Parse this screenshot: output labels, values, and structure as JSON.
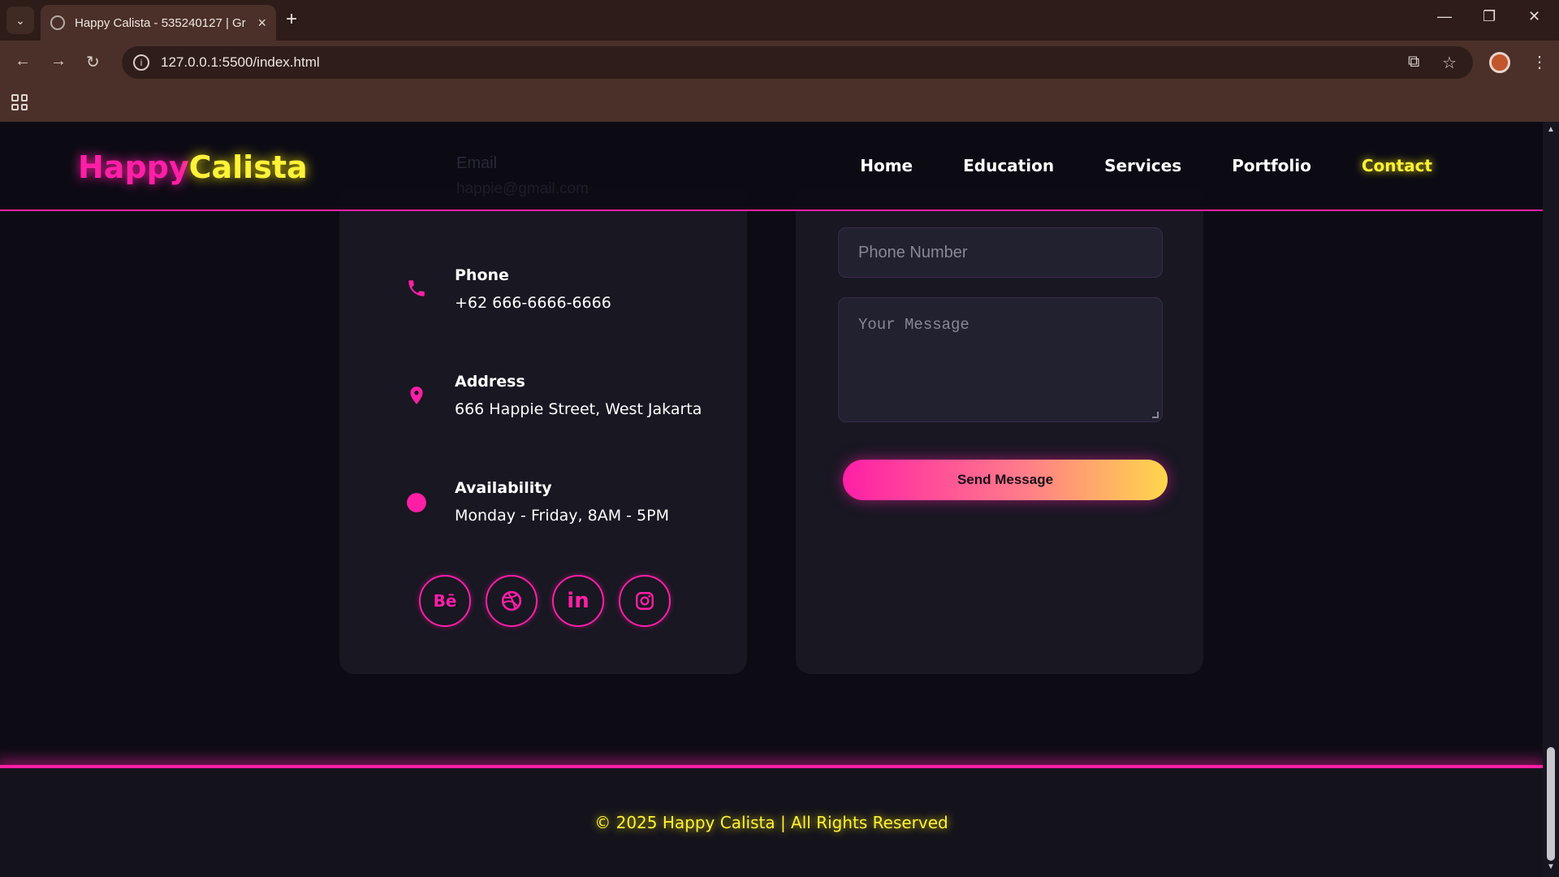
{
  "browser": {
    "tab_title": "Happy Calista - 535240127 | Gr",
    "new_tab_symbol": "+",
    "url": "127.0.0.1:5500/index.html"
  },
  "site": {
    "logo_happy": "Happy",
    "logo_calista": "Calista",
    "nav": [
      {
        "label": "Home"
      },
      {
        "label": "Education"
      },
      {
        "label": "Services"
      },
      {
        "label": "Portfolio"
      },
      {
        "label": "Contact",
        "active": true
      }
    ],
    "ghost_email_label": "Email",
    "ghost_email_value": "happie@gmail.com"
  },
  "contact_info": {
    "phone": {
      "label": "Phone",
      "value": "+62 666-6666-6666",
      "icon": "phone-icon"
    },
    "address": {
      "label": "Address",
      "value": "666 Happie Street, West Jakarta",
      "icon": "location-pin-icon"
    },
    "availability": {
      "label": "Availability",
      "value": "Monday - Friday, 8AM - 5PM",
      "icon": "clock-icon"
    },
    "socials": [
      {
        "name": "behance",
        "glyph": "Bē"
      },
      {
        "name": "dribbble",
        "glyph": ""
      },
      {
        "name": "linkedin",
        "glyph": "in"
      },
      {
        "name": "instagram",
        "glyph": ""
      }
    ]
  },
  "form": {
    "phone_placeholder": "Phone Number",
    "message_placeholder": "Your Message",
    "send_label": "Send Message"
  },
  "footer": {
    "text": "© 2025 Happy Calista | All Rights Reserved"
  },
  "colors": {
    "accent_pink": "#ff1fa6",
    "accent_yellow": "#fff23a",
    "background": "#0d0c14",
    "card": "#181722"
  }
}
